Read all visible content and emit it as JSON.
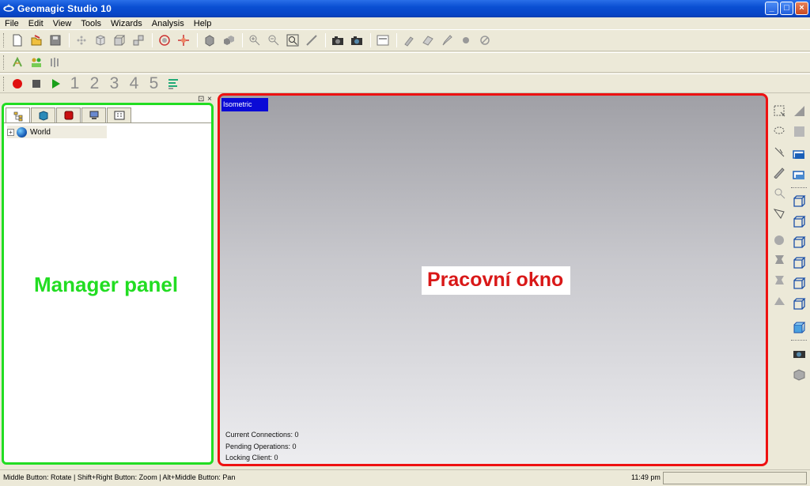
{
  "window": {
    "title": "Geomagic Studio 10"
  },
  "menu": [
    "File",
    "Edit",
    "View",
    "Tools",
    "Wizards",
    "Analysis",
    "Help"
  ],
  "toolbar3": {
    "numbers": [
      "1",
      "2",
      "3",
      "4",
      "5"
    ]
  },
  "manager": {
    "tree_root": "World",
    "annotation": "Manager panel"
  },
  "viewport": {
    "view_label": "Isometric",
    "annotation": "Pracovní okno",
    "status": {
      "connections": "Current Connections: 0",
      "pending": "Pending Operations: 0",
      "locking": "Locking Client: 0"
    }
  },
  "statusbar": {
    "hint": "Middle Button: Rotate | Shift+Right Button: Zoom | Alt+Middle Button: Pan",
    "time": "11:49 pm"
  },
  "colors": {
    "manager_highlight": "#22dd22",
    "viewport_highlight": "#e11111",
    "view_label_bg": "#0a0ad6",
    "titlebar": "#0a4fd2"
  }
}
